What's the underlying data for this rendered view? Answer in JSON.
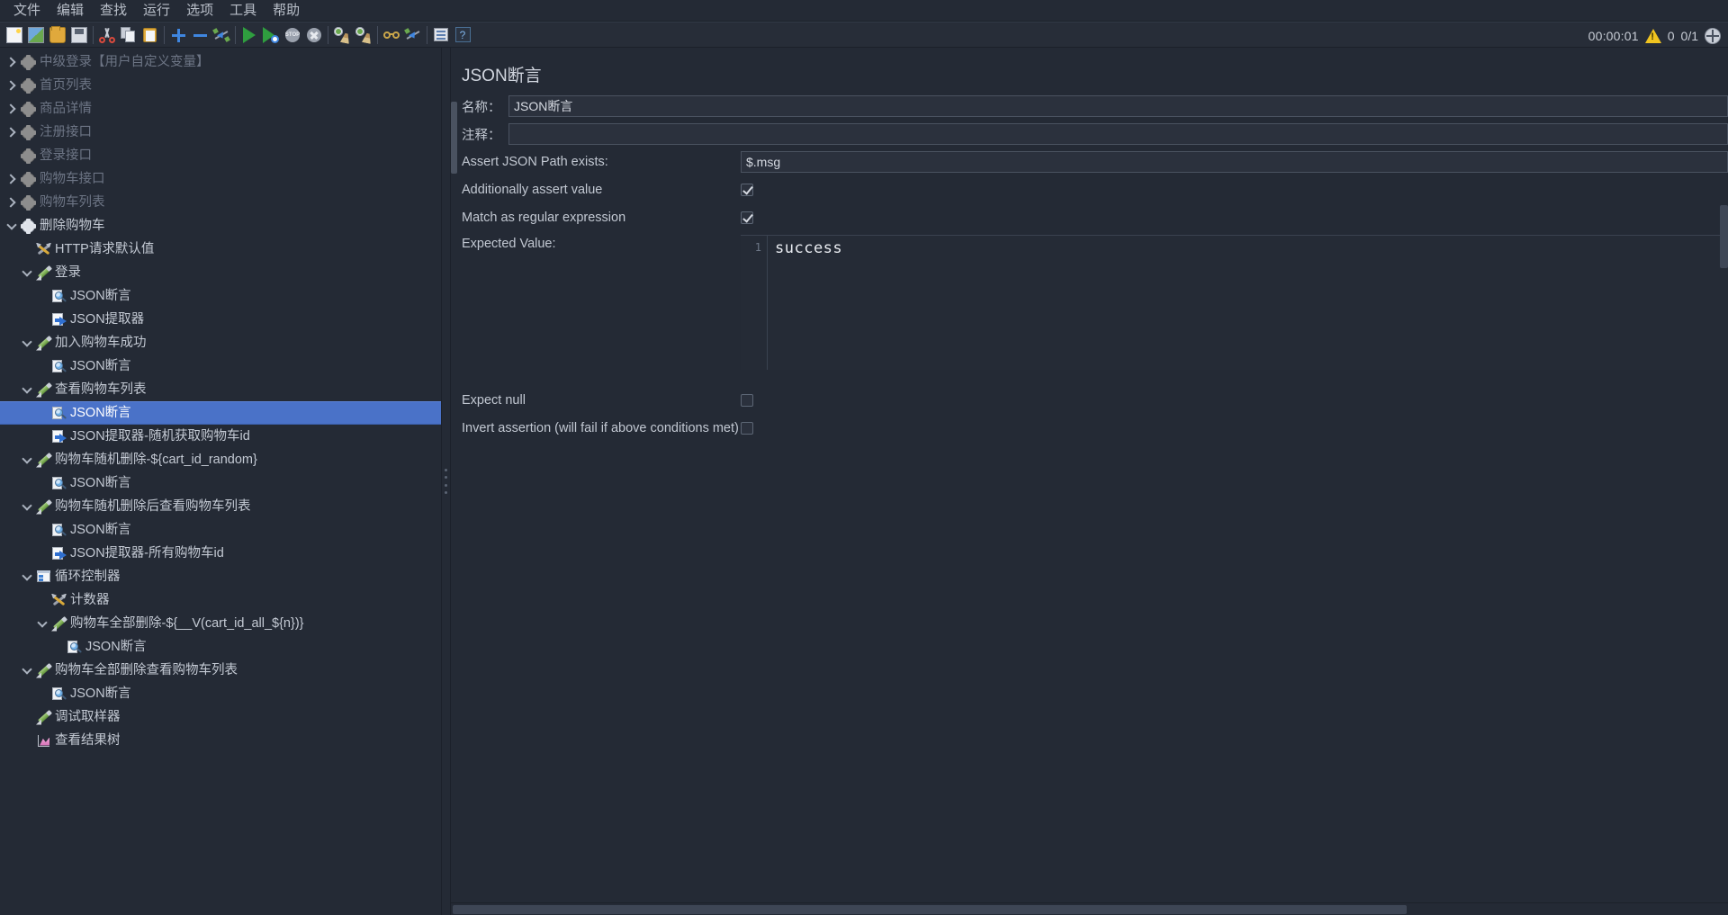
{
  "menubar": {
    "items": [
      {
        "label": "文件",
        "name": "menu-file"
      },
      {
        "label": "编辑",
        "name": "menu-edit"
      },
      {
        "label": "查找",
        "name": "menu-search"
      },
      {
        "label": "运行",
        "name": "menu-run"
      },
      {
        "label": "选项",
        "name": "menu-options"
      },
      {
        "label": "工具",
        "name": "menu-tools"
      },
      {
        "label": "帮助",
        "name": "menu-help"
      }
    ]
  },
  "toolbar": {
    "buttons": [
      {
        "name": "new-icon",
        "title": "New"
      },
      {
        "name": "templates-icon",
        "title": "Templates"
      },
      {
        "name": "open-icon",
        "title": "Open"
      },
      {
        "name": "save-icon",
        "title": "Save"
      },
      {
        "name": "cut-icon",
        "title": "Cut"
      },
      {
        "name": "copy-icon",
        "title": "Copy"
      },
      {
        "name": "paste-icon",
        "title": "Paste"
      },
      {
        "name": "expand-all-icon",
        "title": "Expand all"
      },
      {
        "name": "collapse-all-icon",
        "title": "Collapse all"
      },
      {
        "name": "toggle-icon",
        "title": "Toggle"
      },
      {
        "name": "start-icon",
        "title": "Start"
      },
      {
        "name": "start-no-pauses-icon",
        "title": "Start no pauses"
      },
      {
        "name": "stop-icon",
        "title": "Stop"
      },
      {
        "name": "shutdown-icon",
        "title": "Shutdown"
      },
      {
        "name": "clear-icon",
        "title": "Clear"
      },
      {
        "name": "clear-all-icon",
        "title": "Clear all"
      },
      {
        "name": "function-helper-icon",
        "title": "Function helper"
      },
      {
        "name": "search-icon",
        "title": "Search"
      },
      {
        "name": "log-viewer-icon",
        "title": "Log viewer"
      },
      {
        "name": "help-icon",
        "title": "Help"
      }
    ],
    "status": {
      "timer": "00:00:01",
      "warning_count": "0",
      "threads": "0/1"
    }
  },
  "tree": {
    "rows": [
      {
        "label": "中级登录【用户自定义变量】",
        "icon": "gear",
        "indent": 0,
        "toggle": "right",
        "disabled": true
      },
      {
        "label": "首页列表",
        "icon": "gear",
        "indent": 0,
        "toggle": "right",
        "disabled": true
      },
      {
        "label": "商品详情",
        "icon": "gear",
        "indent": 0,
        "toggle": "right",
        "disabled": true
      },
      {
        "label": "注册接口",
        "icon": "gear",
        "indent": 0,
        "toggle": "right",
        "disabled": true
      },
      {
        "label": "登录接口",
        "icon": "gear",
        "indent": 0,
        "toggle": "none",
        "disabled": true
      },
      {
        "label": "购物车接口",
        "icon": "gear",
        "indent": 0,
        "toggle": "right",
        "disabled": true
      },
      {
        "label": "购物车列表",
        "icon": "gear",
        "indent": 0,
        "toggle": "right",
        "disabled": true
      },
      {
        "label": "删除购物车",
        "icon": "gear-blue",
        "indent": 0,
        "toggle": "down",
        "disabled": false
      },
      {
        "label": "HTTP请求默认值",
        "icon": "wrench",
        "indent": 1,
        "toggle": "none",
        "disabled": false
      },
      {
        "label": "登录",
        "icon": "pencil",
        "indent": 1,
        "toggle": "down",
        "disabled": false
      },
      {
        "label": "JSON断言",
        "icon": "assert",
        "indent": 2,
        "toggle": "none",
        "disabled": false
      },
      {
        "label": "JSON提取器",
        "icon": "extract",
        "indent": 2,
        "toggle": "none",
        "disabled": false
      },
      {
        "label": "加入购物车成功",
        "icon": "pencil",
        "indent": 1,
        "toggle": "down",
        "disabled": false
      },
      {
        "label": "JSON断言",
        "icon": "assert",
        "indent": 2,
        "toggle": "none",
        "disabled": false
      },
      {
        "label": "查看购物车列表",
        "icon": "pencil",
        "indent": 1,
        "toggle": "down",
        "disabled": false
      },
      {
        "label": "JSON断言",
        "icon": "assert",
        "indent": 2,
        "toggle": "none",
        "disabled": false,
        "selected": true
      },
      {
        "label": "JSON提取器-随机获取购物车id",
        "icon": "extract",
        "indent": 2,
        "toggle": "none",
        "disabled": false
      },
      {
        "label": "购物车随机删除-${cart_id_random}",
        "icon": "pencil",
        "indent": 1,
        "toggle": "down",
        "disabled": false
      },
      {
        "label": "JSON断言",
        "icon": "assert",
        "indent": 2,
        "toggle": "none",
        "disabled": false
      },
      {
        "label": "购物车随机删除后查看购物车列表",
        "icon": "pencil",
        "indent": 1,
        "toggle": "down",
        "disabled": false
      },
      {
        "label": "JSON断言",
        "icon": "assert",
        "indent": 2,
        "toggle": "none",
        "disabled": false
      },
      {
        "label": "JSON提取器-所有购物车id",
        "icon": "extract",
        "indent": 2,
        "toggle": "none",
        "disabled": false
      },
      {
        "label": "循环控制器",
        "icon": "loop",
        "indent": 1,
        "toggle": "down",
        "disabled": false
      },
      {
        "label": "计数器",
        "icon": "wrench",
        "indent": 2,
        "toggle": "none",
        "disabled": false
      },
      {
        "label": "购物车全部删除-${__V(cart_id_all_${n})}",
        "icon": "pencil",
        "indent": 2,
        "toggle": "down",
        "disabled": false
      },
      {
        "label": "JSON断言",
        "icon": "assert",
        "indent": 3,
        "toggle": "none",
        "disabled": false
      },
      {
        "label": "购物车全部删除查看购物车列表",
        "icon": "pencil",
        "indent": 1,
        "toggle": "down",
        "disabled": false
      },
      {
        "label": "JSON断言",
        "icon": "assert",
        "indent": 2,
        "toggle": "none",
        "disabled": false
      },
      {
        "label": "调试取样器",
        "icon": "pencil",
        "indent": 1,
        "toggle": "none",
        "disabled": false
      },
      {
        "label": "查看结果树",
        "icon": "tree",
        "indent": 1,
        "toggle": "none",
        "disabled": false
      }
    ]
  },
  "panel": {
    "title": "JSON断言",
    "name_label": "名称：",
    "name_value": "JSON断言",
    "comment_label": "注释：",
    "comment_value": "",
    "assert_path_label": "Assert JSON Path exists:",
    "assert_path_value": "$.msg",
    "additionally_assert_label": "Additionally assert value",
    "additionally_assert_checked": true,
    "match_regex_label": "Match as regular expression",
    "match_regex_checked": true,
    "expected_value_label": "Expected Value:",
    "expected_value_line_number": "1",
    "expected_value_text": "success",
    "expect_null_label": "Expect null",
    "expect_null_checked": false,
    "invert_label": "Invert assertion (will fail if above conditions met)",
    "invert_checked": false
  }
}
